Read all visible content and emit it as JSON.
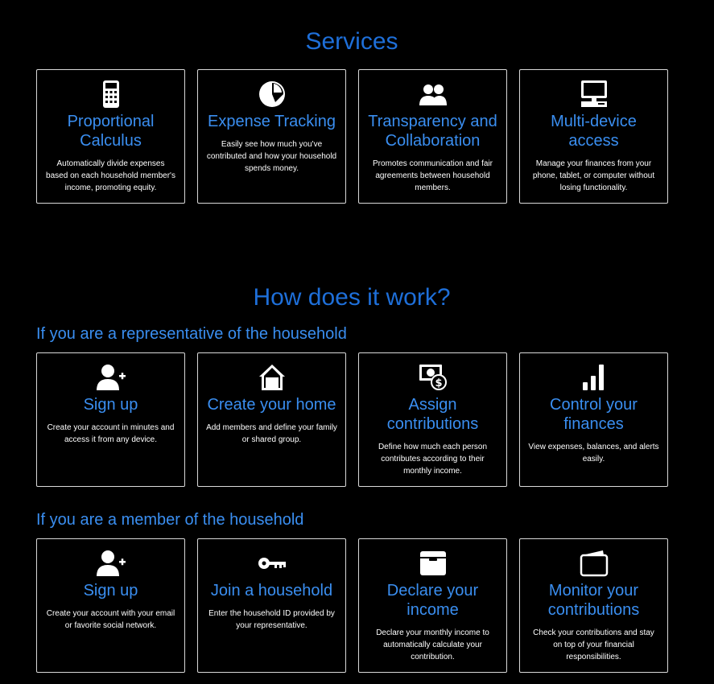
{
  "services": {
    "title": "Services",
    "cards": [
      {
        "icon": "calculator-icon",
        "title": "Proportional Calculus",
        "desc": "Automatically divide expenses based on each household member's income, promoting equity."
      },
      {
        "icon": "pie-chart-icon",
        "title": "Expense Tracking",
        "desc": "Easily see how much you've contributed and how your household spends money."
      },
      {
        "icon": "users-icon",
        "title": "Transparency and Collaboration",
        "desc": "Promotes communication and fair agreements between household members."
      },
      {
        "icon": "computer-icon",
        "title": "Multi-device access",
        "desc": "Manage your finances from your phone, tablet, or computer without losing functionality."
      }
    ]
  },
  "how": {
    "title": "How does it work?",
    "representative": {
      "title": "If you are a representative of the household",
      "cards": [
        {
          "icon": "user-plus-icon",
          "title": "Sign up",
          "desc": "Create your account in minutes and access it from any device."
        },
        {
          "icon": "home-icon",
          "title": "Create your home",
          "desc": "Add members and define your family or shared group."
        },
        {
          "icon": "money-bill-icon",
          "title": "Assign contributions",
          "desc": "Define how much each person contributes according to their monthly income."
        },
        {
          "icon": "signal-bars-icon",
          "title": "Control your finances",
          "desc": "View expenses, balances, and alerts easily."
        }
      ]
    },
    "member": {
      "title": "If you are a member of the household",
      "cards": [
        {
          "icon": "user-plus-icon",
          "title": "Sign up",
          "desc": "Create your account with your email or favorite social network."
        },
        {
          "icon": "key-icon",
          "title": "Join a household",
          "desc": "Enter the household ID provided by your representative."
        },
        {
          "icon": "inbox-icon",
          "title": "Declare your income",
          "desc": "Declare your monthly income to automatically calculate your contribution."
        },
        {
          "icon": "wallet-icon",
          "title": "Monitor your contributions",
          "desc": "Check your contributions and stay on top of your financial responsibilities."
        }
      ]
    }
  }
}
